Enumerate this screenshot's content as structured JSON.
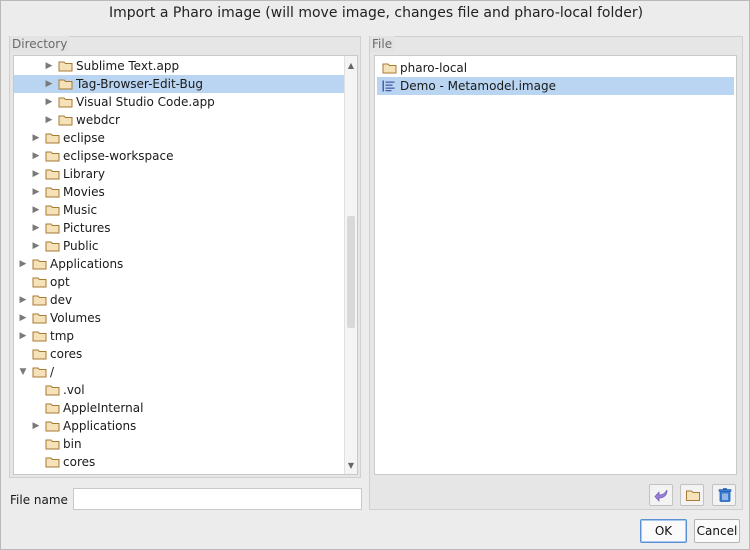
{
  "dialog": {
    "title": "Import a Pharo image (will move image, changes file and pharo-local folder)"
  },
  "directory": {
    "label": "Directory",
    "items": [
      {
        "label": "Sublime Text.app",
        "expandable": true,
        "selected": false
      },
      {
        "label": "Tag-Browser-Edit-Bug",
        "expandable": true,
        "selected": true
      },
      {
        "label": "Visual Studio Code.app",
        "expandable": true,
        "selected": false
      },
      {
        "label": "webdcr",
        "expandable": true,
        "selected": false
      },
      {
        "label": "eclipse",
        "expandable": true,
        "selected": false
      },
      {
        "label": "eclipse-workspace",
        "expandable": true,
        "selected": false
      },
      {
        "label": "Library",
        "expandable": true,
        "selected": false
      },
      {
        "label": "Movies",
        "expandable": true,
        "selected": false
      },
      {
        "label": "Music",
        "expandable": true,
        "selected": false
      },
      {
        "label": "Pictures",
        "expandable": true,
        "selected": false
      },
      {
        "label": "Public",
        "expandable": true,
        "selected": false
      },
      {
        "label": "Applications",
        "expandable": true,
        "selected": false
      },
      {
        "label": "opt",
        "expandable": false,
        "selected": false
      },
      {
        "label": "dev",
        "expandable": true,
        "selected": false
      },
      {
        "label": "Volumes",
        "expandable": true,
        "selected": false
      },
      {
        "label": "tmp",
        "expandable": true,
        "selected": false
      },
      {
        "label": "cores",
        "expandable": false,
        "selected": false
      },
      {
        "label": "/",
        "expandable": true,
        "expanded": true,
        "selected": false
      },
      {
        "label": ".vol",
        "expandable": false,
        "selected": false
      },
      {
        "label": "AppleInternal",
        "expandable": false,
        "selected": false
      },
      {
        "label": "Applications",
        "expandable": true,
        "selected": false
      },
      {
        "label": "bin",
        "expandable": false,
        "selected": false
      },
      {
        "label": "cores",
        "expandable": false,
        "selected": false
      }
    ]
  },
  "file": {
    "label": "File",
    "items": [
      {
        "label": "pharo-local",
        "icon": "folder-icon",
        "selected": false
      },
      {
        "label": "Demo - Metamodel.image",
        "icon": "list-icon",
        "selected": true
      }
    ]
  },
  "filename": {
    "label": "File name",
    "value": ""
  },
  "buttons": {
    "ok": "OK",
    "cancel": "Cancel"
  },
  "colors": {
    "selection": "#b9d5f2",
    "folder": "#c89b55",
    "accent": "#5b8fd6"
  }
}
